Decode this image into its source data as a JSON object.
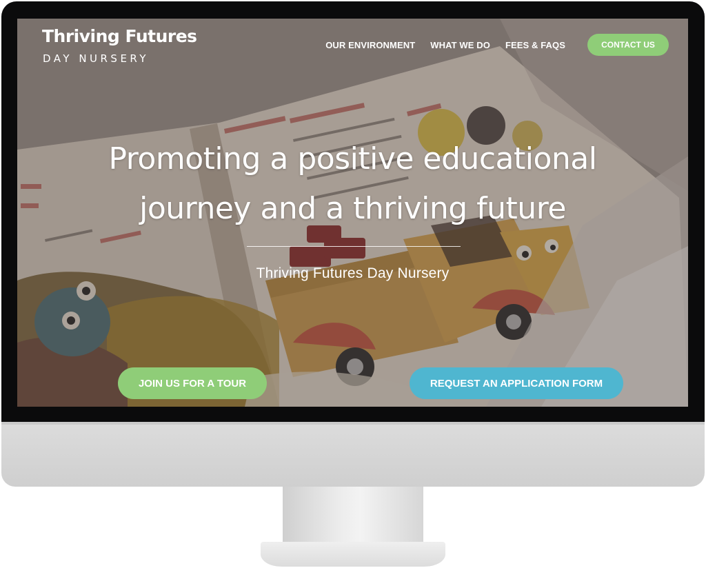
{
  "logo": {
    "line1": "Thriving Futures",
    "line2": "DAY NURSERY"
  },
  "nav": {
    "items": [
      {
        "label": "OUR ENVIRONMENT"
      },
      {
        "label": "WHAT WE DO"
      },
      {
        "label": "FEES & FAQS"
      }
    ],
    "contact_label": "CONTACT US"
  },
  "hero": {
    "title_line1": "Promoting a positive educational",
    "title_line2": "journey and a thriving future",
    "subtitle": "Thriving Futures Day Nursery"
  },
  "cta": {
    "tour_label": "JOIN US FOR A TOUR",
    "apply_label": "REQUEST AN APPLICATION FORM"
  },
  "colors": {
    "green_accent": "#8fcd78",
    "blue_accent": "#4fb6d0",
    "bezel": "#0b0b0c",
    "chin": "#d6d6d6"
  }
}
